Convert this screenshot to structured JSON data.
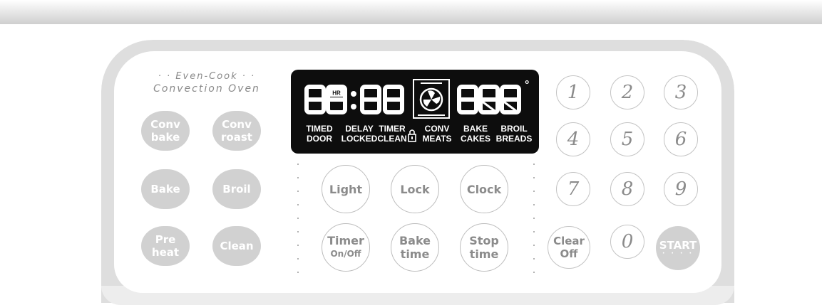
{
  "brand": {
    "line1": "· · Even-Cook · ·",
    "line2": "Convection Oven"
  },
  "display": {
    "time_digits": "88:88",
    "hr_indicator": "HR",
    "temp_digits": "888",
    "degree_symbol": "°",
    "indicator_labels": [
      {
        "top": "TIMED",
        "bottom": "DOOR"
      },
      {
        "top": "DELAY",
        "bottom": "LOCKED"
      },
      {
        "top": "TIMER",
        "bottom": "CLEAN"
      },
      {
        "top": "CONV",
        "bottom": "MEATS"
      },
      {
        "top": "BAKE",
        "bottom": "CAKES"
      },
      {
        "top": "BROIL",
        "bottom": "BREADS"
      }
    ],
    "lock_icon": "padlock-icon",
    "fan_icon": "convection-fan-icon"
  },
  "function_buttons": {
    "conv_bake": {
      "line1": "Conv",
      "line2": "bake"
    },
    "conv_roast": {
      "line1": "Conv",
      "line2": "roast"
    },
    "bake": "Bake",
    "broil": "Broil",
    "preheat": {
      "line1": "Pre",
      "line2": "heat"
    },
    "clean": "Clean"
  },
  "control_buttons": {
    "light": "Light",
    "lock": "Lock",
    "clock": "Clock",
    "timer": {
      "line1": "Timer",
      "line2": "On/Off"
    },
    "bake_time": {
      "line1": "Bake",
      "line2": "time"
    },
    "stop_time": {
      "line1": "Stop",
      "line2": "time"
    }
  },
  "keypad": {
    "digits": [
      "1",
      "2",
      "3",
      "4",
      "5",
      "6",
      "7",
      "8",
      "9",
      "0"
    ],
    "clear": {
      "line1": "Clear",
      "line2": "Off"
    },
    "start": "START",
    "start_dots": "· · · ·"
  },
  "colors": {
    "accent_button_fill": "#d1d1d1",
    "display_background": "#0d0d0d",
    "panel_frame": "#dedede"
  }
}
